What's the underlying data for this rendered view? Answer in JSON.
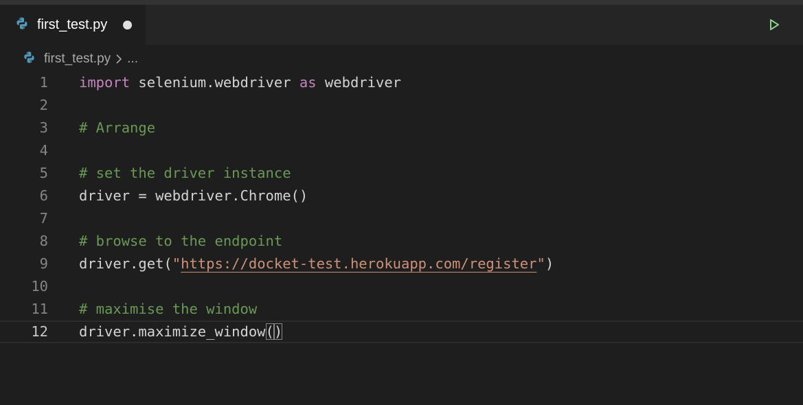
{
  "tab": {
    "label": "first_test.py",
    "icon": "python-icon",
    "modified": true
  },
  "toolbar": {
    "run_icon": "run-icon"
  },
  "breadcrumb": {
    "file": "first_test.py",
    "separator_icon": "chevron-right-icon",
    "more": "..."
  },
  "editor": {
    "language": "python",
    "current_line": 12,
    "lines": [
      {
        "n": "1",
        "parts": [
          {
            "t": "import",
            "c": "kw"
          },
          {
            "t": " selenium.webdriver ",
            "c": ""
          },
          {
            "t": "as",
            "c": "kw"
          },
          {
            "t": " webdriver",
            "c": ""
          }
        ]
      },
      {
        "n": "2",
        "parts": []
      },
      {
        "n": "3",
        "parts": [
          {
            "t": "# Arrange",
            "c": "cm"
          }
        ]
      },
      {
        "n": "4",
        "parts": []
      },
      {
        "n": "5",
        "parts": [
          {
            "t": "# set the driver instance",
            "c": "cm"
          }
        ]
      },
      {
        "n": "6",
        "parts": [
          {
            "t": "driver = webdriver.Chrome()",
            "c": ""
          }
        ]
      },
      {
        "n": "7",
        "parts": []
      },
      {
        "n": "8",
        "parts": [
          {
            "t": "# browse to the endpoint",
            "c": "cm"
          }
        ]
      },
      {
        "n": "9",
        "parts": [
          {
            "t": "driver.get(",
            "c": ""
          },
          {
            "t": "\"",
            "c": "str"
          },
          {
            "t": "https://docket-test.herokuapp.com/register",
            "c": "url"
          },
          {
            "t": "\"",
            "c": "str"
          },
          {
            "t": ")",
            "c": ""
          }
        ]
      },
      {
        "n": "10",
        "parts": []
      },
      {
        "n": "11",
        "parts": [
          {
            "t": "# maximise the window",
            "c": "cm"
          }
        ]
      },
      {
        "n": "12",
        "parts": [
          {
            "t": "driver.maximize_window",
            "c": ""
          },
          {
            "t": "(",
            "c": "bm"
          },
          {
            "t": ")",
            "c": "bm"
          }
        ]
      }
    ]
  },
  "colors": {
    "background": "#1e1e1e",
    "keyword": "#c586c0",
    "comment": "#6a9955",
    "string": "#ce9178",
    "text": "#d4d4d4",
    "run_icon": "#89d185"
  }
}
